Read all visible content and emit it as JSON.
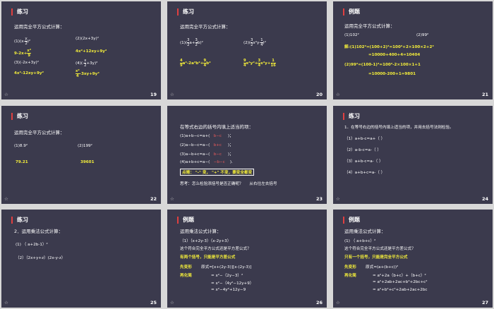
{
  "slides": [
    {
      "id": 19,
      "title": "练习",
      "num": "19",
      "intro": "运用完全平方公式计算：",
      "items": [
        "(1)(x-",
        "(2)(2x+3y)²",
        "(3)(-2x+3y)²",
        "(4)(-"
      ],
      "frac1": {
        "n": "y",
        "d": "2"
      },
      "tail1": ")²",
      "frac2": {
        "n": "x",
        "d": "2"
      },
      "tail2": "+3y)²",
      "answers": [
        "9-2x+",
        "4x²+12xy+9y²",
        "4x²-12xy+9y²",
        "-3xy+9y²"
      ],
      "afrac1": {
        "n": "x²",
        "d": "9"
      },
      "afrac4": {
        "n": "x²",
        "d": "4"
      }
    },
    {
      "id": 20,
      "title": "练习",
      "num": "20",
      "intro": "运用完全平方公式计算：",
      "q1": "(1)(",
      "q1f1": {
        "n": "3",
        "d": "2"
      },
      "q1m": "a+",
      "q1f2": {
        "n": "3",
        "d": "2"
      },
      "q1t": "b)²",
      "q2": "(2)(",
      "q2f1": {
        "n": "3",
        "d": "2"
      },
      "q2m": "x²y-",
      "q2f2": {
        "n": "1",
        "d": "4"
      },
      "q2t": ")²",
      "a1f1": {
        "n": "4",
        "d": "9"
      },
      "a1m": "a²-2a²b²+",
      "a1f2": {
        "n": "9",
        "d": "4"
      },
      "a1t": "b²",
      "a2f1": {
        "n": "9",
        "d": "4"
      },
      "a2m": "x⁴y²+",
      "a2f2": {
        "n": "3",
        "d": "4"
      },
      "a2m2": "x²y+",
      "a2f3": {
        "n": "1",
        "d": "16"
      }
    },
    {
      "id": 21,
      "title": "例题",
      "num": "21",
      "intro": "运用完全平方公式计算：",
      "q1": "(1)102²",
      "q2": "(2)99²",
      "lines": [
        "解:(1)102²=(100+2)²=100²+2×100×2+2²",
        "=10000+400+4=10404",
        "(2)99²=(100-1)²=100²-2×100×1+1",
        "=10000-200+1=9801"
      ]
    },
    {
      "id": 22,
      "title": "练习",
      "num": "22",
      "intro": "运用完全平方公式计算：",
      "q1": "(1)8.9²",
      "q2": "(2)199²",
      "a1": "79.21",
      "a2": "39601"
    },
    {
      "id": 23,
      "num": "23",
      "intro": "在等式右边的括号内填上适当的项：",
      "rows": [
        {
          "pre": "(1)a+b−c=a+(",
          "ans": "b−c",
          "post": ")；"
        },
        {
          "pre": "(2)a−b−c=a−(",
          "ans": "b+c",
          "post": ")；"
        },
        {
          "pre": "(3)a−b+c=a−(",
          "ans": "b−c",
          "post": ")；"
        },
        {
          "pre": "(4)a+b+c=a−(",
          "ans": "−b−c",
          "post": ")."
        }
      ],
      "tip": "点睛：  \"-\" 变， \"+\" 不变，要变全都变",
      "think": "思考：怎么检验添括号是否正确呢？",
      "think2": "从右往左去括号"
    },
    {
      "id": 24,
      "title": "练习",
      "num": "24",
      "intro": "1．在等号右边的括号内填上适当的项，并用去括号法则检验。",
      "rows": [
        "（1）a+b-c=a+（        ）",
        "（2）a-b-c=a-（        ）",
        "（3）a+b-c=a-（        ）",
        "（4）a+b+c=a-（        ）"
      ]
    },
    {
      "id": 25,
      "title": "练习",
      "num": "25",
      "intro": "2．运用乘法公式计算：",
      "q1": "(1)   （  a+2b-1）²",
      "q2": "（2）（2x+y+z）(2x-y-z）"
    },
    {
      "id": 26,
      "title": "例题",
      "num": "26",
      "intro": "运用乘法公式计算：",
      "q": "（1）（x+2y-3）（x-2y+3）",
      "ask": "这个符合完全平方公式还是平方差公式？",
      "hint": "有两个括号，只能是平方差公式",
      "lab1": "先变形",
      "lab2": "再化简",
      "l1": "原式=[x+(2y-3)][x-(2y-3)]",
      "l2": "= x²−（2y−3）²",
      "l3": "= x²−（4y²−12y+9）",
      "l4": "= x²−4y²+12y−9"
    },
    {
      "id": 27,
      "title": "例题",
      "num": "27",
      "intro": "运用乘法公式计算：",
      "q": "(1)   （  a+b+c）²",
      "ask": "这个符合完全平方公式还是平方差公式？",
      "hint": "只有一个括号，只能是完全平方公式",
      "lab1": "先变形",
      "lab2": "再化简",
      "l1": "原式=(a+(b+c))²",
      "l2": "= a²+2a（b+c）+（b+c）²",
      "l3": "= a²+2ab+2ac+b²+2bc+c²",
      "l4": "= a²+b²+c²+2ab+2ac+2bc"
    }
  ],
  "footer_star": "☆"
}
